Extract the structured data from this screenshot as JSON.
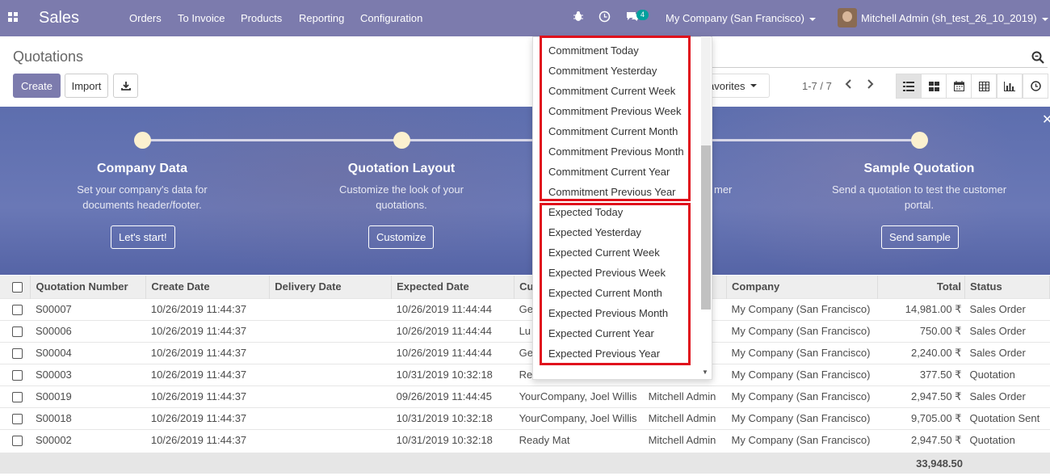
{
  "app": {
    "title": "Sales",
    "menu": [
      "Orders",
      "To Invoice",
      "Products",
      "Reporting",
      "Configuration"
    ],
    "messages_count": "4",
    "company": "My Company (San Francisco)",
    "user": "Mitchell Admin (sh_test_26_10_2019)"
  },
  "control_panel": {
    "breadcrumb": "Quotations",
    "create_label": "Create",
    "import_label": "Import",
    "favorites_label": "avorites",
    "pager": "1-7 / 7"
  },
  "banner": {
    "steps": [
      {
        "title": "Company Data",
        "desc": "Set your company's data for documents header/footer.",
        "button": "Let's start!"
      },
      {
        "title": "Quotation Layout",
        "desc": "Customize the look of your quotations.",
        "button": "Customize"
      },
      {
        "title": "",
        "desc": "mer",
        "button": ""
      },
      {
        "title": "Sample Quotation",
        "desc": "Send a quotation to test the customer portal.",
        "button": "Send sample"
      }
    ]
  },
  "dropdown": {
    "commitment": [
      "Commitment Today",
      "Commitment Yesterday",
      "Commitment Current Week",
      "Commitment Previous Week",
      "Commitment Current Month",
      "Commitment Previous Month",
      "Commitment Current Year",
      "Commitment Previous Year"
    ],
    "expected": [
      "Expected Today",
      "Expected Yesterday",
      "Expected Current Week",
      "Expected Previous Week",
      "Expected Current Month",
      "Expected Previous Month",
      "Expected Current Year",
      "Expected Previous Year"
    ]
  },
  "table": {
    "headers": {
      "number": "Quotation Number",
      "create_date": "Create Date",
      "delivery_date": "Delivery Date",
      "expected_date": "Expected Date",
      "customer": "Cu",
      "salesperson": "",
      "company": "Company",
      "total": "Total",
      "status": "Status"
    },
    "rows": [
      {
        "number": "S00007",
        "create_date": "10/26/2019 11:44:37",
        "delivery_date": "",
        "expected_date": "10/26/2019 11:44:44",
        "customer": "Ge",
        "salesperson": "",
        "company": "My Company (San Francisco)",
        "total": "14,981.00 ₹",
        "status": "Sales Order"
      },
      {
        "number": "S00006",
        "create_date": "10/26/2019 11:44:37",
        "delivery_date": "",
        "expected_date": "10/26/2019 11:44:44",
        "customer": "Lu",
        "salesperson": "",
        "company": "My Company (San Francisco)",
        "total": "750.00 ₹",
        "status": "Sales Order"
      },
      {
        "number": "S00004",
        "create_date": "10/26/2019 11:44:37",
        "delivery_date": "",
        "expected_date": "10/26/2019 11:44:44",
        "customer": "Ge",
        "salesperson": "",
        "company": "My Company (San Francisco)",
        "total": "2,240.00 ₹",
        "status": "Sales Order"
      },
      {
        "number": "S00003",
        "create_date": "10/26/2019 11:44:37",
        "delivery_date": "",
        "expected_date": "10/31/2019 10:32:18",
        "customer": "Re",
        "salesperson": "",
        "company": "My Company (San Francisco)",
        "total": "377.50 ₹",
        "status": "Quotation"
      },
      {
        "number": "S00019",
        "create_date": "10/26/2019 11:44:37",
        "delivery_date": "",
        "expected_date": "09/26/2019 11:44:45",
        "customer": "YourCompany, Joel Willis",
        "salesperson": "Mitchell Admin",
        "company": "My Company (San Francisco)",
        "total": "2,947.50 ₹",
        "status": "Sales Order"
      },
      {
        "number": "S00018",
        "create_date": "10/26/2019 11:44:37",
        "delivery_date": "",
        "expected_date": "10/31/2019 10:32:18",
        "customer": "YourCompany, Joel Willis",
        "salesperson": "Mitchell Admin",
        "company": "My Company (San Francisco)",
        "total": "9,705.00 ₹",
        "status": "Quotation Sent"
      },
      {
        "number": "S00002",
        "create_date": "10/26/2019 11:44:37",
        "delivery_date": "",
        "expected_date": "10/31/2019 10:32:18",
        "customer": "Ready Mat",
        "salesperson": "Mitchell Admin",
        "company": "My Company (San Francisco)",
        "total": "2,947.50 ₹",
        "status": "Quotation"
      }
    ],
    "grand_total": "33,948.50"
  },
  "colors": {
    "brand": "#7c7bad",
    "highlight": "#e0111c"
  }
}
